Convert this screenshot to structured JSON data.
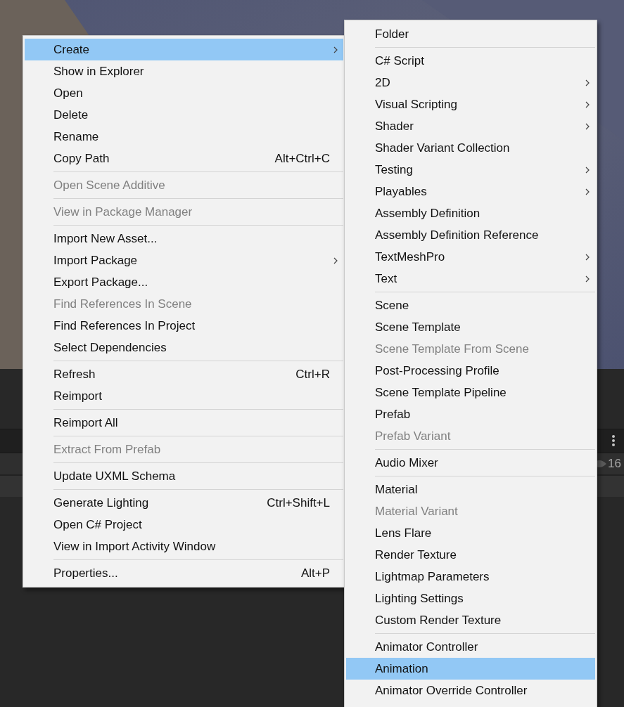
{
  "hierarchy_panel": {
    "count": "16"
  },
  "context_menu": {
    "sections": [
      [
        {
          "label": "Create",
          "has_submenu": true,
          "disabled": false,
          "selected": true
        },
        {
          "label": "Show in Explorer",
          "has_submenu": false,
          "disabled": false,
          "selected": false
        },
        {
          "label": "Open",
          "has_submenu": false,
          "disabled": false,
          "selected": false
        },
        {
          "label": "Delete",
          "has_submenu": false,
          "disabled": false,
          "selected": false
        },
        {
          "label": "Rename",
          "has_submenu": false,
          "disabled": false,
          "selected": false
        },
        {
          "label": "Copy Path",
          "shortcut": "Alt+Ctrl+C",
          "has_submenu": false,
          "disabled": false,
          "selected": false
        }
      ],
      [
        {
          "label": "Open Scene Additive",
          "has_submenu": false,
          "disabled": true,
          "selected": false
        }
      ],
      [
        {
          "label": "View in Package Manager",
          "has_submenu": false,
          "disabled": true,
          "selected": false
        }
      ],
      [
        {
          "label": "Import New Asset...",
          "has_submenu": false,
          "disabled": false,
          "selected": false
        },
        {
          "label": "Import Package",
          "has_submenu": true,
          "disabled": false,
          "selected": false
        },
        {
          "label": "Export Package...",
          "has_submenu": false,
          "disabled": false,
          "selected": false
        },
        {
          "label": "Find References In Scene",
          "has_submenu": false,
          "disabled": true,
          "selected": false
        },
        {
          "label": "Find References In Project",
          "has_submenu": false,
          "disabled": false,
          "selected": false
        },
        {
          "label": "Select Dependencies",
          "has_submenu": false,
          "disabled": false,
          "selected": false
        }
      ],
      [
        {
          "label": "Refresh",
          "shortcut": "Ctrl+R",
          "has_submenu": false,
          "disabled": false,
          "selected": false
        },
        {
          "label": "Reimport",
          "has_submenu": false,
          "disabled": false,
          "selected": false
        }
      ],
      [
        {
          "label": "Reimport All",
          "has_submenu": false,
          "disabled": false,
          "selected": false
        }
      ],
      [
        {
          "label": "Extract From Prefab",
          "has_submenu": false,
          "disabled": true,
          "selected": false
        }
      ],
      [
        {
          "label": "Update UXML Schema",
          "has_submenu": false,
          "disabled": false,
          "selected": false
        }
      ],
      [
        {
          "label": "Generate Lighting",
          "shortcut": "Ctrl+Shift+L",
          "has_submenu": false,
          "disabled": false,
          "selected": false
        },
        {
          "label": "Open C# Project",
          "has_submenu": false,
          "disabled": false,
          "selected": false
        },
        {
          "label": "View in Import Activity Window",
          "has_submenu": false,
          "disabled": false,
          "selected": false
        }
      ],
      [
        {
          "label": "Properties...",
          "shortcut": "Alt+P",
          "has_submenu": false,
          "disabled": false,
          "selected": false
        }
      ]
    ]
  },
  "create_submenu": {
    "sections": [
      [
        {
          "label": "Folder",
          "has_submenu": false,
          "disabled": false,
          "selected": false
        }
      ],
      [
        {
          "label": "C# Script",
          "has_submenu": false,
          "disabled": false,
          "selected": false
        },
        {
          "label": "2D",
          "has_submenu": true,
          "disabled": false,
          "selected": false
        },
        {
          "label": "Visual Scripting",
          "has_submenu": true,
          "disabled": false,
          "selected": false
        },
        {
          "label": "Shader",
          "has_submenu": true,
          "disabled": false,
          "selected": false
        },
        {
          "label": "Shader Variant Collection",
          "has_submenu": false,
          "disabled": false,
          "selected": false
        },
        {
          "label": "Testing",
          "has_submenu": true,
          "disabled": false,
          "selected": false
        },
        {
          "label": "Playables",
          "has_submenu": true,
          "disabled": false,
          "selected": false
        },
        {
          "label": "Assembly Definition",
          "has_submenu": false,
          "disabled": false,
          "selected": false
        },
        {
          "label": "Assembly Definition Reference",
          "has_submenu": false,
          "disabled": false,
          "selected": false
        },
        {
          "label": "TextMeshPro",
          "has_submenu": true,
          "disabled": false,
          "selected": false
        },
        {
          "label": "Text",
          "has_submenu": true,
          "disabled": false,
          "selected": false
        }
      ],
      [
        {
          "label": "Scene",
          "has_submenu": false,
          "disabled": false,
          "selected": false
        },
        {
          "label": "Scene Template",
          "has_submenu": false,
          "disabled": false,
          "selected": false
        },
        {
          "label": "Scene Template From Scene",
          "has_submenu": false,
          "disabled": true,
          "selected": false
        },
        {
          "label": "Post-Processing Profile",
          "has_submenu": false,
          "disabled": false,
          "selected": false
        },
        {
          "label": "Scene Template Pipeline",
          "has_submenu": false,
          "disabled": false,
          "selected": false
        },
        {
          "label": "Prefab",
          "has_submenu": false,
          "disabled": false,
          "selected": false
        },
        {
          "label": "Prefab Variant",
          "has_submenu": false,
          "disabled": true,
          "selected": false
        }
      ],
      [
        {
          "label": "Audio Mixer",
          "has_submenu": false,
          "disabled": false,
          "selected": false
        }
      ],
      [
        {
          "label": "Material",
          "has_submenu": false,
          "disabled": false,
          "selected": false
        },
        {
          "label": "Material Variant",
          "has_submenu": false,
          "disabled": true,
          "selected": false
        },
        {
          "label": "Lens Flare",
          "has_submenu": false,
          "disabled": false,
          "selected": false
        },
        {
          "label": "Render Texture",
          "has_submenu": false,
          "disabled": false,
          "selected": false
        },
        {
          "label": "Lightmap Parameters",
          "has_submenu": false,
          "disabled": false,
          "selected": false
        },
        {
          "label": "Lighting Settings",
          "has_submenu": false,
          "disabled": false,
          "selected": false
        },
        {
          "label": "Custom Render Texture",
          "has_submenu": false,
          "disabled": false,
          "selected": false
        }
      ],
      [
        {
          "label": "Animator Controller",
          "has_submenu": false,
          "disabled": false,
          "selected": false
        },
        {
          "label": "Animation",
          "has_submenu": false,
          "disabled": false,
          "selected": true
        },
        {
          "label": "Animator Override Controller",
          "has_submenu": false,
          "disabled": false,
          "selected": false
        }
      ]
    ]
  }
}
